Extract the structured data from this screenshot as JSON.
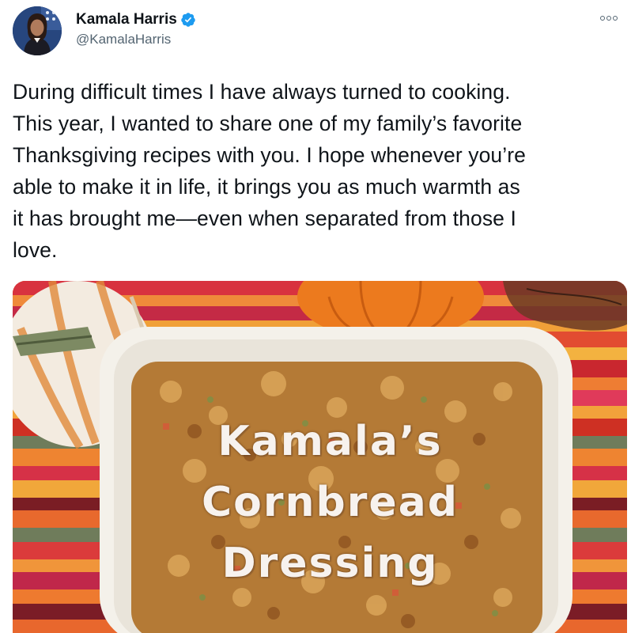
{
  "author": {
    "display_name": "Kamala Harris",
    "handle": "@KamalaHarris",
    "verified": true
  },
  "tweet": {
    "text": "During difficult times I have always turned to cooking.\nThis year, I wanted to share one of my family’s favorite\nThanksgiving recipes with you. I hope whenever you’re\nable to make it in life, it brings you as much warmth as\nit has brought me—even when separated from those I\nlove."
  },
  "media": {
    "overlay_lines": [
      "Kamala’s",
      "Cornbread",
      "Dressing"
    ]
  },
  "icons": {
    "verified": "verified-badge-icon",
    "more": "more-options-icon"
  },
  "colors": {
    "verified_blue": "#1d9bf0",
    "handle_gray": "#536471",
    "text": "#0f1419"
  }
}
